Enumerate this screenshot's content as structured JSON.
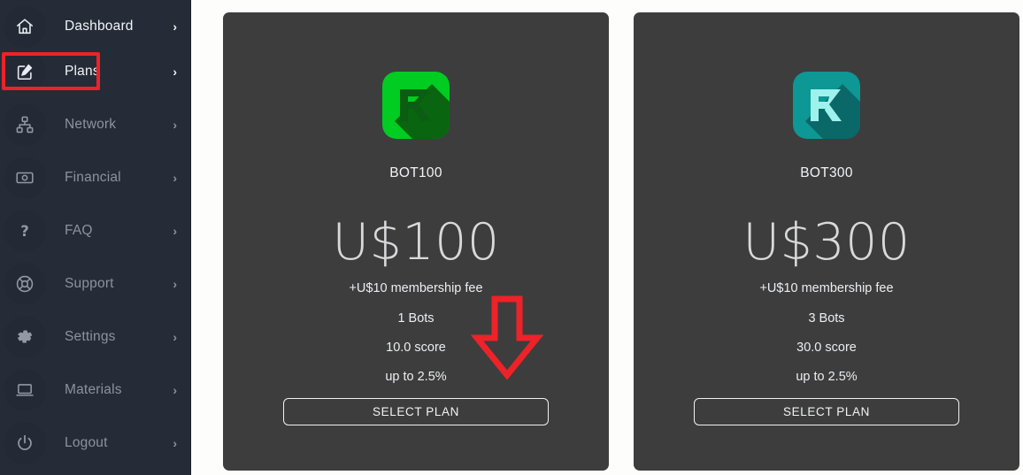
{
  "sidebar": {
    "items": [
      {
        "label": "Dashboard",
        "icon": "home-icon",
        "key": "dashboard",
        "chevron": "›",
        "state": "bright"
      },
      {
        "label": "Plans",
        "icon": "edit-icon",
        "key": "plans",
        "chevron": "›",
        "state": "active"
      },
      {
        "label": "Network",
        "icon": "network-icon",
        "key": "network",
        "chevron": "›",
        "state": "normal"
      },
      {
        "label": "Financial",
        "icon": "money-icon",
        "key": "financial",
        "chevron": "›",
        "state": "normal"
      },
      {
        "label": "FAQ",
        "icon": "question-icon",
        "key": "faq",
        "chevron": "›",
        "state": "normal"
      },
      {
        "label": "Support",
        "icon": "lifebuoy-icon",
        "key": "support",
        "chevron": "›",
        "state": "normal"
      },
      {
        "label": "Settings",
        "icon": "gear-icon",
        "key": "settings",
        "chevron": "›",
        "state": "normal"
      },
      {
        "label": "Materials",
        "icon": "laptop-icon",
        "key": "materials",
        "chevron": "›",
        "state": "normal"
      },
      {
        "label": "Logout",
        "icon": "power-icon",
        "key": "logout",
        "chevron": "›",
        "state": "normal"
      }
    ]
  },
  "annotations": {
    "highlight_box_target": "Plans",
    "highlight_color": "#ee2229",
    "arrow_name": "down-arrow-annotation",
    "arrow_color": "#ee2229",
    "arrow_points_to": "SELECT PLAN"
  },
  "plans": [
    {
      "name": "BOT100",
      "price": "U$100",
      "fee": "+U$10 membership fee",
      "features": [
        "1 Bots",
        "10.0 score",
        "up to 2.5%"
      ],
      "button_label": "SELECT PLAN",
      "logo": {
        "name": "fx-logo-icon",
        "bg": "#00cc22",
        "mark": "#0a5d12",
        "shadow": "#0c3d0a"
      }
    },
    {
      "name": "BOT300",
      "price": "U$300",
      "fee": "+U$10 membership fee",
      "features": [
        "3 Bots",
        "30.0 score",
        "up to 2.5%"
      ],
      "button_label": "SELECT PLAN",
      "logo": {
        "name": "fx-logo-icon",
        "bg": "#0d9795",
        "mark": "#9ff2ec",
        "shadow": "#0a5f62"
      }
    }
  ],
  "theme": {
    "page_bg": "#fdfdfc",
    "sidebar_bg": "#252c38",
    "card_bg": "#3d3d3d",
    "text_muted": "#8b939f",
    "text_bright": "#f2f4f7"
  }
}
